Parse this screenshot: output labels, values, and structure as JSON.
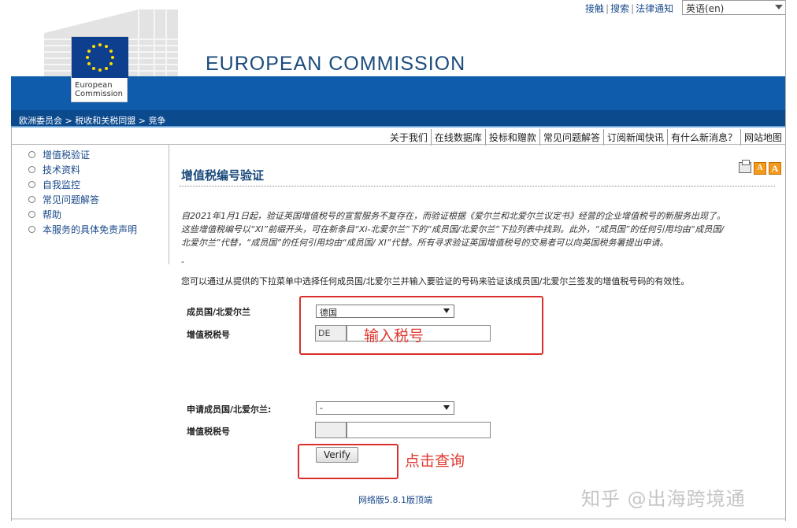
{
  "top_links": {
    "contact": "接触",
    "search": "搜索",
    "legal": "法律通知",
    "language": "英语(en)"
  },
  "header": {
    "logo_line1": "European",
    "logo_line2": "Commission",
    "title": "EUROPEAN COMMISSION"
  },
  "breadcrumb": {
    "part1": "欧洲委员会",
    "part2": "税收和关税同盟",
    "part3": "竞争"
  },
  "topnav": [
    "关于我们",
    "在线数据库",
    "投标和赠款",
    "常见问题解答",
    "订阅新闻快讯",
    "有什么新消息？",
    "网站地图"
  ],
  "sidebar": {
    "items": [
      "增值税验证",
      "技术资料",
      "自我监控",
      "常见问题解答",
      "帮助",
      "本服务的具体免责声明"
    ]
  },
  "main": {
    "title": "增值税编号验证",
    "notice_line1": "自2021年1月1日起，验证英国增值税号的宣誓服务不复存在，而验证根据《爱尔兰和北爱尔兰议定书》经营的企业增值税号的新服务出现了。",
    "notice_line2": "这些增值税编号以“XI”前缀开头，可在新条目“Xi-北爱尔兰”下的“成员国/北爱尔兰”下拉列表中找到。此外，“成员国”的任何引用均由“成员国/",
    "notice_line3": "北爱尔兰”代替，“成员国”的任何引用均由“成员国/ XI”代替。所有寻求验证英国增值税号的交易者可以向英国税务署提出申请。",
    "notice_dash": "-",
    "intro": "您可以通过从提供的下拉菜单中选择任何成员国/北爱尔兰并输入要验证的号码来验证该成员国/北爱尔兰签发的增值税号码的有效性。"
  },
  "form": {
    "member_state_label": "成员国/北爱尔兰",
    "member_state_value": "德国",
    "vat_label": "增值税税号",
    "vat_prefix": "DE",
    "vat_value": "",
    "requester_label": "申请成员国/北爱尔兰:",
    "requester_value": "-",
    "requester_vat_label": "增值税税号",
    "requester_prefix": "",
    "requester_vat_value": "",
    "verify_button": "Verify"
  },
  "annotations": {
    "input_hint": "输入税号",
    "click_hint": "点击查询"
  },
  "footer": {
    "version": "网络版5.8.1版",
    "top_link": "顶端"
  },
  "watermark": "知乎 @出海跨境通",
  "colors": {
    "eu_blue": "#0e5cab",
    "title_blue": "#1b4b7c",
    "annotation_red": "#d9302c"
  }
}
